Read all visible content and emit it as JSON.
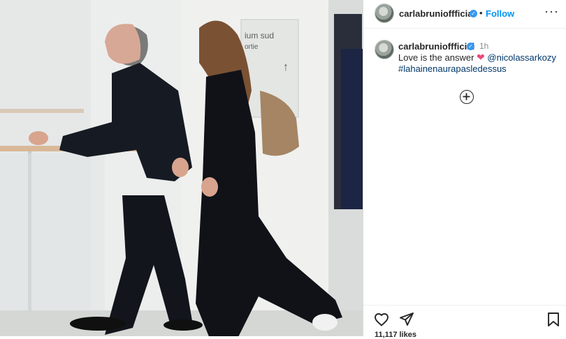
{
  "post": {
    "username": "carlabrunioffficial",
    "follow_label": "Follow",
    "separator": "•",
    "more_label": "···",
    "caption": {
      "username": "carlabrunioffficial",
      "time": "1h",
      "text": "Love is the answer",
      "heart": "❤",
      "mention": "@nicolassarkozy",
      "hashtag": "#lahainenaurapasledessus"
    },
    "likes": "11,117 likes"
  },
  "photo": {
    "sign_text": "ium sud",
    "sign_subtext": "ortie",
    "sign_arrow": "↑"
  },
  "icons": {
    "verified": "verified-icon",
    "more": "more-options-icon",
    "load_more": "plus-circle-icon",
    "like": "heart-icon",
    "share": "paper-plane-icon",
    "save": "bookmark-icon"
  },
  "colors": {
    "link": "#0095f6",
    "verified": "#3897f0",
    "mention": "#00376b",
    "heart": "#ed4979"
  }
}
